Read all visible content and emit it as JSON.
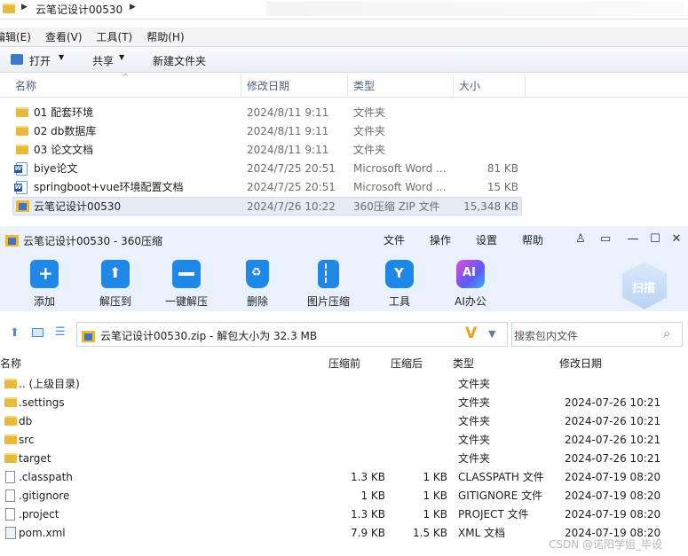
{
  "explorer": {
    "address": "云笔记设计00530",
    "menu": [
      "编辑(E)",
      "查看(V)",
      "工具(T)",
      "帮助(H)"
    ],
    "toolbar": {
      "open": "打开",
      "share": "共享",
      "new_folder": "新建文件夹"
    },
    "columns": {
      "name": "名称",
      "date": "修改日期",
      "type": "类型",
      "size": "大小"
    },
    "rows": [
      {
        "name": "01 配套环境",
        "date": "2024/8/11 9:11",
        "type": "文件夹",
        "size": "",
        "icon": "folder-icon"
      },
      {
        "name": "02 db数据库",
        "date": "2024/8/11 9:11",
        "type": "文件夹",
        "size": "",
        "icon": "folder-icon"
      },
      {
        "name": "03 论文文档",
        "date": "2024/8/11 9:11",
        "type": "文件夹",
        "size": "",
        "icon": "folder-icon"
      },
      {
        "name": "biye论文",
        "date": "2024/7/25 20:51",
        "type": "Microsoft Word ...",
        "size": "81 KB",
        "icon": "word-doc-icon"
      },
      {
        "name": "springboot+vue环境配置文档",
        "date": "2024/7/25 20:51",
        "type": "Microsoft Word ...",
        "size": "15 KB",
        "icon": "word-doc-icon"
      },
      {
        "name": "云笔记设计00530",
        "date": "2024/7/26 10:22",
        "type": "360压缩 ZIP 文件",
        "size": "15,348 KB",
        "icon": "zip-icon"
      }
    ]
  },
  "zip": {
    "title": "云笔记设计00530 - 360压缩",
    "menu": [
      "文件",
      "操作",
      "设置",
      "帮助"
    ],
    "tools": [
      {
        "label": "添加",
        "icon": "add-icon",
        "color": "#1f87e5"
      },
      {
        "label": "解压到",
        "icon": "extract-to-icon",
        "color": "#1f87e5"
      },
      {
        "label": "一键解压",
        "icon": "one-click-extract-icon",
        "color": "#1f87e5"
      },
      {
        "label": "删除",
        "icon": "delete-icon",
        "color": "#1f87e5"
      },
      {
        "label": "图片压缩",
        "icon": "image-compress-icon",
        "color": "#1f87e5"
      },
      {
        "label": "工具",
        "icon": "tools-icon",
        "color": "#1f87e5"
      },
      {
        "label": "AI办公",
        "icon": "ai-office-icon",
        "color": "#6a4cf0"
      }
    ],
    "scan": "扫描",
    "path": "云笔记设计00530.zip - 解包大小为 32.3 MB",
    "search_placeholder": "搜索包内文件",
    "columns": {
      "name": "名称",
      "before": "压缩前",
      "after": "压缩后",
      "type": "类型",
      "date": "修改日期"
    },
    "rows": [
      {
        "name": ".. (上级目录)",
        "before": "",
        "after": "",
        "type": "文件夹",
        "date": "",
        "icon": "folder-icon"
      },
      {
        "name": ".settings",
        "before": "",
        "after": "",
        "type": "文件夹",
        "date": "2024-07-26 10:21",
        "icon": "folder-icon"
      },
      {
        "name": "db",
        "before": "",
        "after": "",
        "type": "文件夹",
        "date": "2024-07-26 10:21",
        "icon": "folder-icon"
      },
      {
        "name": "src",
        "before": "",
        "after": "",
        "type": "文件夹",
        "date": "2024-07-26 10:21",
        "icon": "folder-icon"
      },
      {
        "name": "target",
        "before": "",
        "after": "",
        "type": "文件夹",
        "date": "2024-07-26 10:21",
        "icon": "folder-icon"
      },
      {
        "name": ".classpath",
        "before": "1.3 KB",
        "after": "1 KB",
        "type": "CLASSPATH 文件",
        "date": "2024-07-19 08:20",
        "icon": "file-icon"
      },
      {
        "name": ".gitignore",
        "before": "1 KB",
        "after": "1 KB",
        "type": "GITIGNORE 文件",
        "date": "2024-07-19 08:20",
        "icon": "file-icon"
      },
      {
        "name": ".project",
        "before": "1.3 KB",
        "after": "1 KB",
        "type": "PROJECT 文件",
        "date": "2024-07-19 08:20",
        "icon": "file-icon"
      },
      {
        "name": "pom.xml",
        "before": "7.9 KB",
        "after": "1.5 KB",
        "type": "XML 文档",
        "date": "2024-07-19 08:20",
        "icon": "xml-file-icon"
      }
    ]
  },
  "watermark": "CSDN @诺阳学姐_毕设"
}
